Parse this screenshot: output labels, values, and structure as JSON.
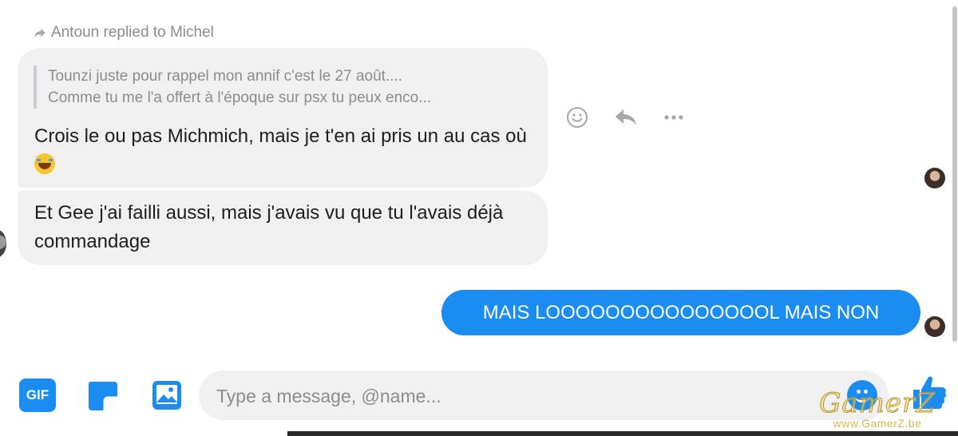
{
  "thread": {
    "reply_header": "Antoun replied to Michel",
    "quoted_line_1": "Tounzi juste pour rappel mon annif c'est le 27 août....",
    "quoted_line_2": "Comme tu me l'a offert à l'époque sur psx tu peux enco...",
    "message_1_text": "Crois le ou pas Michmich, mais je t'en ai pris un au cas où",
    "message_1_emoji": "tears-of-joy-emoji",
    "message_2_text": "Et Gee j'ai failli aussi, mais j'avais vu que tu l'avais déjà commandage",
    "message_out_text": "MAIS LOOOOOOOOOOOOOOOL MAIS NON"
  },
  "actions": {
    "icons": [
      "smiley-icon",
      "reply-icon",
      "more-icon"
    ]
  },
  "composer": {
    "gif_label": "GIF",
    "placeholder": "Type a message, @name...",
    "value": ""
  },
  "watermark": {
    "brand": "GamerZ",
    "site": "www.GamerZ.be"
  },
  "colors": {
    "accent": "#1b8cf2",
    "bubble_in": "#f0f0f0",
    "muted_text": "#8a8d91"
  }
}
